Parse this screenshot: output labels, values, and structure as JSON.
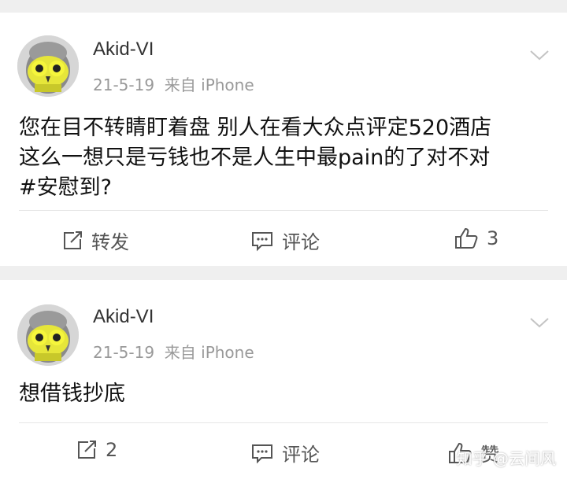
{
  "posts": [
    {
      "username": "Akid-VI",
      "date": "21-5-19",
      "source": "来自 iPhone",
      "content_lines": [
        "您在目不转睛盯着盘 别人在看大众点评定520酒店",
        "这么一想只是亏钱也不是人生中最pain的了对不对",
        "#安慰到?"
      ],
      "repost_label": "转发",
      "comment_label": "评论",
      "like_count": "3"
    },
    {
      "username": "Akid-VI",
      "date": "21-5-19",
      "source": "来自 iPhone",
      "content_lines": [
        "想借钱抄底"
      ],
      "repost_count": "2",
      "comment_label": "评论",
      "like_label": "赞"
    }
  ],
  "watermark": "知乎 @云间风",
  "icons": {
    "chevron": "chevron-down-icon",
    "repost": "repost-icon",
    "comment": "comment-icon",
    "like": "thumbs-up-icon"
  }
}
